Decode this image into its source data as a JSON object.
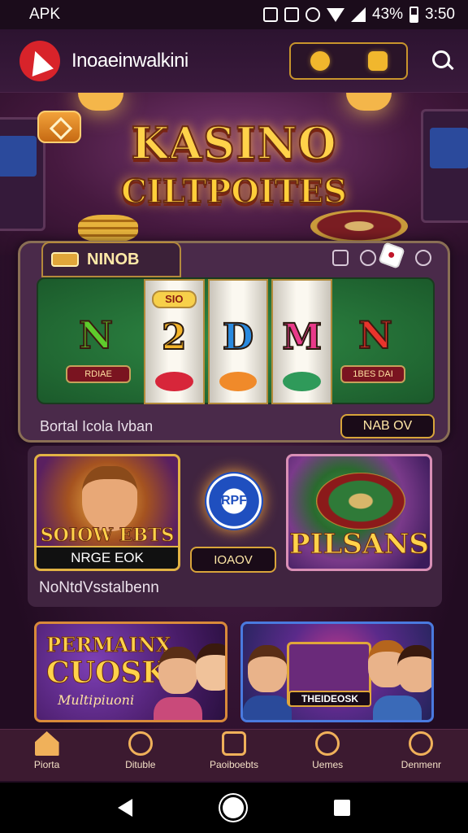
{
  "status_bar": {
    "carrier": "APK",
    "battery": "43%",
    "time": "3:50"
  },
  "header": {
    "app_title": "Inoaeinwalkini"
  },
  "hero": {
    "title_line1": "KASINO",
    "title_line2": "CILTPOITES"
  },
  "game_panel": {
    "tab_label": "NINOB",
    "symbols": {
      "left": "N",
      "reel1": "2",
      "reel2": "D",
      "reel3": "M",
      "right": "N"
    },
    "reel1_top": "SIO",
    "left_button": "RDIAE",
    "right_button": "1BES DAI",
    "footer_label": "Bortal Icola Ivban",
    "footer_button": "NAB OV"
  },
  "games_section": {
    "card1": {
      "title": "SOIOW EBTS",
      "bar": "NRGE EOK"
    },
    "chip_text": "RPF",
    "mid_button": "IOAOV",
    "card3": {
      "title": "PILSANS"
    },
    "section_label": "NoNtdVsstalbenn"
  },
  "bottom_cards": {
    "card1": {
      "title_line1": "PERMAINX",
      "title_line2": "CUOSK",
      "subtitle": "Multipiuoni"
    },
    "card2": {
      "title": "THEIDEOSK"
    }
  },
  "bottom_nav": {
    "items": [
      {
        "label": "Piorta",
        "icon": "home-icon"
      },
      {
        "label": "Dituble",
        "icon": "wand-icon"
      },
      {
        "label": "Paoiboebts",
        "icon": "document-icon"
      },
      {
        "label": "Uemes",
        "icon": "games-icon"
      },
      {
        "label": "Denmenr",
        "icon": "profile-icon"
      }
    ]
  },
  "colors": {
    "accent_gold": "#f0b15a",
    "background": "#3a1638",
    "felt_green": "#2f8a45"
  }
}
